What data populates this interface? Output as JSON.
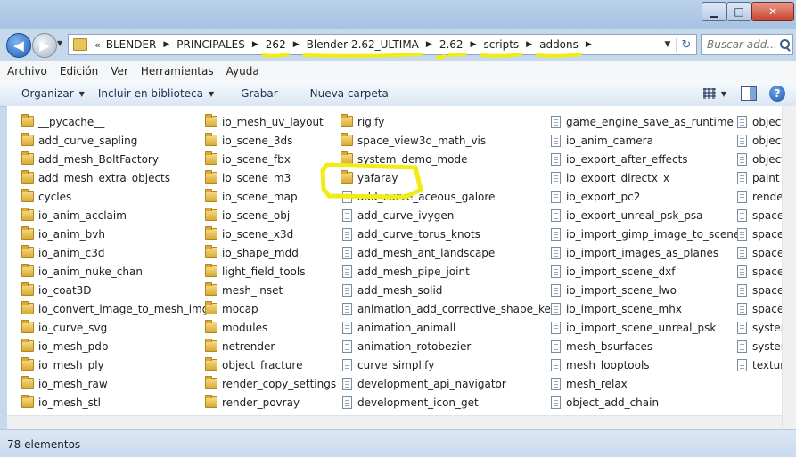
{
  "window": {
    "controls": {
      "minimize": "▁",
      "maximize": "□",
      "close": "✕"
    }
  },
  "nav": {
    "back_icon": "arrow-left-icon",
    "forward_icon": "arrow-right-icon",
    "history_glyph": "▼",
    "overflow": "«",
    "breadcrumbs": [
      "BLENDER",
      "PRINCIPALES",
      "262",
      "Blender 2.62_ULTIMA",
      "2.62",
      "scripts",
      "addons"
    ],
    "crumb_separator": "▶",
    "dropdown_glyph": "▼",
    "refresh_glyph": "↻",
    "search_placeholder": "Buscar add..."
  },
  "menu": [
    "Archivo",
    "Edición",
    "Ver",
    "Herramientas",
    "Ayuda"
  ],
  "commands": {
    "organize": "Organizar",
    "include_library": "Incluir en biblioteca",
    "burn": "Grabar",
    "new_folder": "Nueva carpeta",
    "dropdown_glyph": "▼",
    "help_glyph": "?"
  },
  "files": [
    [
      {
        "name": "__pycache__",
        "type": "folder"
      },
      {
        "name": "add_curve_sapling",
        "type": "folder"
      },
      {
        "name": "add_mesh_BoltFactory",
        "type": "folder"
      },
      {
        "name": "add_mesh_extra_objects",
        "type": "folder"
      },
      {
        "name": "cycles",
        "type": "folder"
      },
      {
        "name": "io_anim_acclaim",
        "type": "folder"
      },
      {
        "name": "io_anim_bvh",
        "type": "folder"
      },
      {
        "name": "io_anim_c3d",
        "type": "folder"
      },
      {
        "name": "io_anim_nuke_chan",
        "type": "folder"
      },
      {
        "name": "io_coat3D",
        "type": "folder"
      },
      {
        "name": "io_convert_image_to_mesh_img",
        "type": "folder"
      },
      {
        "name": "io_curve_svg",
        "type": "folder"
      },
      {
        "name": "io_mesh_pdb",
        "type": "folder"
      },
      {
        "name": "io_mesh_ply",
        "type": "folder"
      },
      {
        "name": "io_mesh_raw",
        "type": "folder"
      },
      {
        "name": "io_mesh_stl",
        "type": "folder"
      }
    ],
    [
      {
        "name": "io_mesh_uv_layout",
        "type": "folder"
      },
      {
        "name": "io_scene_3ds",
        "type": "folder"
      },
      {
        "name": "io_scene_fbx",
        "type": "folder"
      },
      {
        "name": "io_scene_m3",
        "type": "folder"
      },
      {
        "name": "io_scene_map",
        "type": "folder"
      },
      {
        "name": "io_scene_obj",
        "type": "folder"
      },
      {
        "name": "io_scene_x3d",
        "type": "folder"
      },
      {
        "name": "io_shape_mdd",
        "type": "folder"
      },
      {
        "name": "light_field_tools",
        "type": "folder"
      },
      {
        "name": "mesh_inset",
        "type": "folder"
      },
      {
        "name": "mocap",
        "type": "folder"
      },
      {
        "name": "modules",
        "type": "folder"
      },
      {
        "name": "netrender",
        "type": "folder"
      },
      {
        "name": "object_fracture",
        "type": "folder"
      },
      {
        "name": "render_copy_settings",
        "type": "folder"
      },
      {
        "name": "render_povray",
        "type": "folder"
      }
    ],
    [
      {
        "name": "rigify",
        "type": "folder"
      },
      {
        "name": "space_view3d_math_vis",
        "type": "folder"
      },
      {
        "name": "system_demo_mode",
        "type": "folder"
      },
      {
        "name": "yafaray",
        "type": "folder"
      },
      {
        "name": "add_curve_aceous_galore",
        "type": "file"
      },
      {
        "name": "add_curve_ivygen",
        "type": "file"
      },
      {
        "name": "add_curve_torus_knots",
        "type": "file"
      },
      {
        "name": "add_mesh_ant_landscape",
        "type": "file"
      },
      {
        "name": "add_mesh_pipe_joint",
        "type": "file"
      },
      {
        "name": "add_mesh_solid",
        "type": "file"
      },
      {
        "name": "animation_add_corrective_shape_key",
        "type": "file"
      },
      {
        "name": "animation_animall",
        "type": "file"
      },
      {
        "name": "animation_rotobezier",
        "type": "file"
      },
      {
        "name": "curve_simplify",
        "type": "file"
      },
      {
        "name": "development_api_navigator",
        "type": "file"
      },
      {
        "name": "development_icon_get",
        "type": "file"
      }
    ],
    [
      {
        "name": "game_engine_save_as_runtime",
        "type": "file"
      },
      {
        "name": "io_anim_camera",
        "type": "file"
      },
      {
        "name": "io_export_after_effects",
        "type": "file"
      },
      {
        "name": "io_export_directx_x",
        "type": "file"
      },
      {
        "name": "io_export_pc2",
        "type": "file"
      },
      {
        "name": "io_export_unreal_psk_psa",
        "type": "file"
      },
      {
        "name": "io_import_gimp_image_to_scene",
        "type": "file"
      },
      {
        "name": "io_import_images_as_planes",
        "type": "file"
      },
      {
        "name": "io_import_scene_dxf",
        "type": "file"
      },
      {
        "name": "io_import_scene_lwo",
        "type": "file"
      },
      {
        "name": "io_import_scene_mhx",
        "type": "file"
      },
      {
        "name": "io_import_scene_unreal_psk",
        "type": "file"
      },
      {
        "name": "mesh_bsurfaces",
        "type": "file"
      },
      {
        "name": "mesh_looptools",
        "type": "file"
      },
      {
        "name": "mesh_relax",
        "type": "file"
      },
      {
        "name": "object_add_chain",
        "type": "file"
      }
    ],
    [
      {
        "name": "object_an",
        "type": "file"
      },
      {
        "name": "object_cl",
        "type": "file"
      },
      {
        "name": "object_gr",
        "type": "file"
      },
      {
        "name": "paint_pal",
        "type": "file"
      },
      {
        "name": "render_re",
        "type": "file"
      },
      {
        "name": "space_vie",
        "type": "file"
      },
      {
        "name": "space_vie",
        "type": "file"
      },
      {
        "name": "space_vie",
        "type": "file"
      },
      {
        "name": "space_vie",
        "type": "file"
      },
      {
        "name": "space_vie",
        "type": "file"
      },
      {
        "name": "space_vie",
        "type": "file"
      },
      {
        "name": "system_b",
        "type": "file"
      },
      {
        "name": "system_p",
        "type": "file"
      },
      {
        "name": "texture_p",
        "type": "file"
      }
    ]
  ],
  "status": {
    "count": "78 elementos"
  },
  "annotation_color": "#f2ec16"
}
